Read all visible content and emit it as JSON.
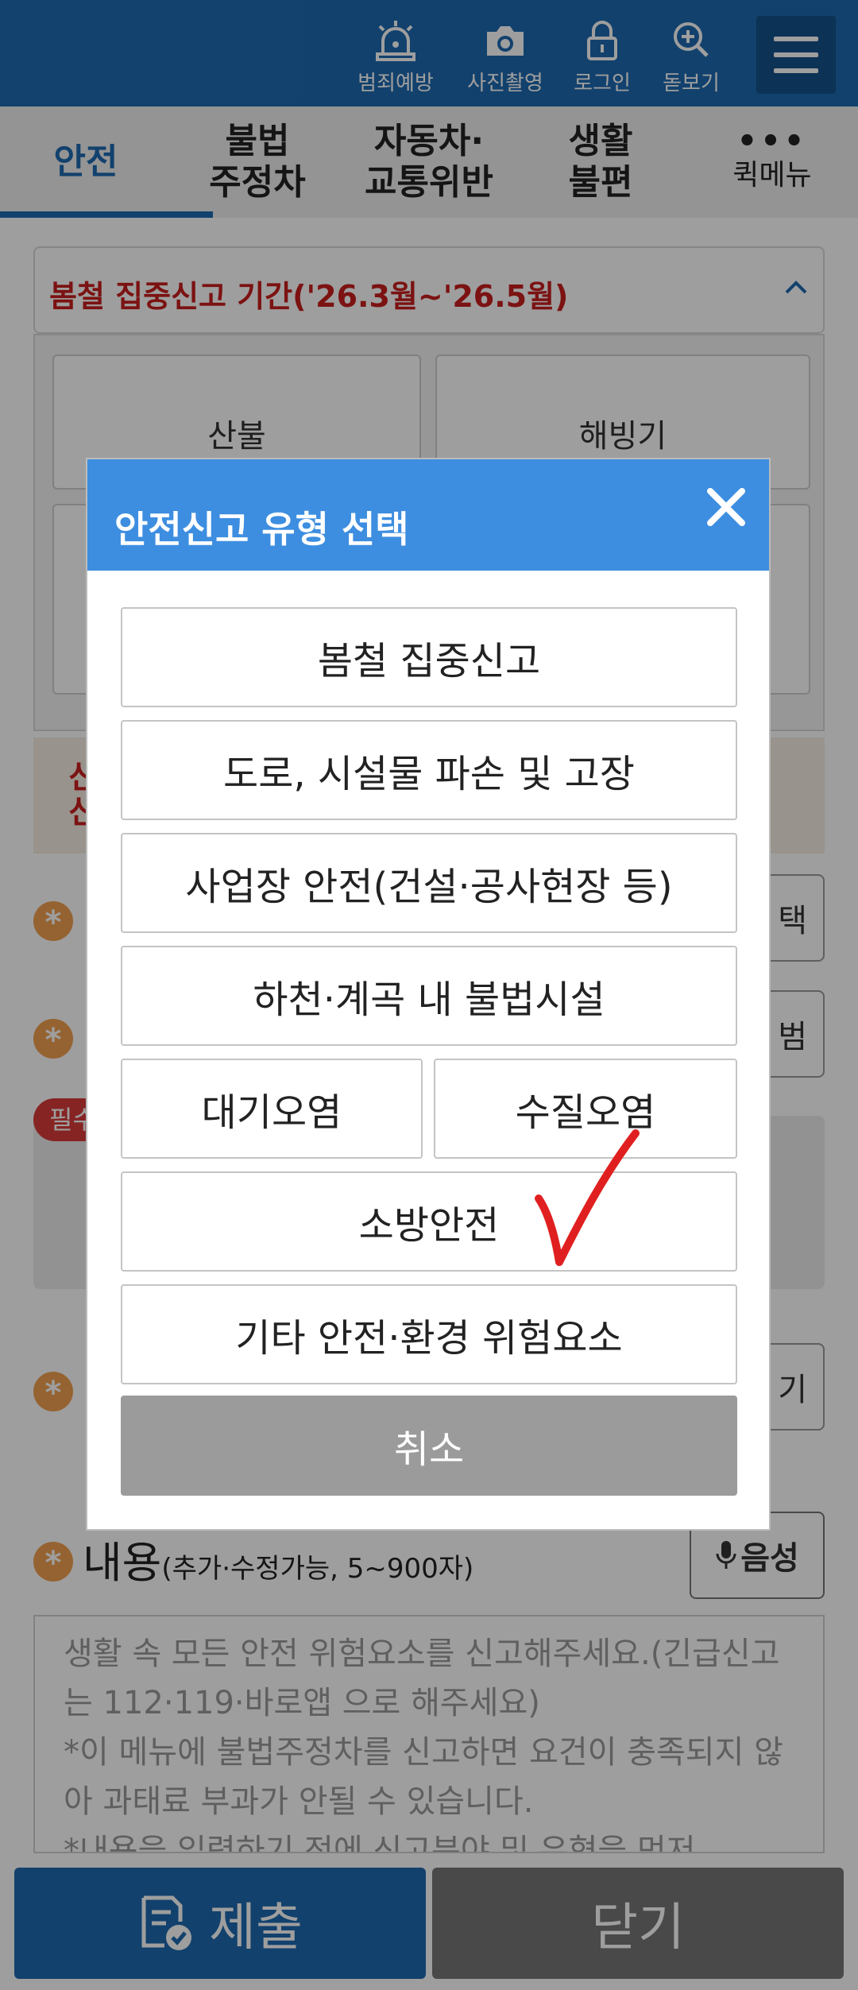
{
  "header": {
    "icons": [
      {
        "name": "siren-icon",
        "label": "범죄예방"
      },
      {
        "name": "camera-icon",
        "label": "사진촬영"
      },
      {
        "name": "lock-icon",
        "label": "로그인"
      },
      {
        "name": "magnifier-icon",
        "label": "돋보기"
      }
    ],
    "menu_icon": "hamburger-icon"
  },
  "tabs": [
    {
      "label": "안전",
      "active": true
    },
    {
      "label": "불법\n주정차"
    },
    {
      "label": "자동차·\n교통위반"
    },
    {
      "label": "생활\n불편"
    },
    {
      "label": "퀵메뉴",
      "icon": "•••"
    }
  ],
  "notice": {
    "text": "봄철 집중신고 기간('26.3월~'26.5월)"
  },
  "categories": [
    {
      "label": "산불\n(불법 취사·소각 등)"
    },
    {
      "label": "해빙기\n(시설물 파손 등)"
    }
  ],
  "content": {
    "label": "내용",
    "hint": "(추가·수정가능, 5~900자)",
    "voice_label": "음성",
    "placeholder": "생활 속 모든 안전 위험요소를 신고해주세요.(긴급신고는 112·119·바로앱 으로 해주세요)\n*이 메뉴에 불법주정차를 신고하면 요건이 충족되지 않아 과태료 부과가 안될 수 있습니다.\n*내용을 입력하기 전에 신고분야 및 유형을 먼저"
  },
  "background_fragments": {
    "side_btn_1": "택",
    "side_btn_2": "범",
    "side_btn_3": "기",
    "required_badge": "필수",
    "banner_text": "신\n신"
  },
  "bottom": {
    "submit_label": "제출",
    "close_label": "닫기"
  },
  "modal": {
    "title": "안전신고 유형 선택",
    "options": [
      "봄철 집중신고",
      "도로, 시설물 파손 및 고장",
      "사업장 안전(건설·공사현장 등)",
      "하천·계곡 내 불법시설",
      "대기오염",
      "수질오염",
      "소방안전",
      "기타 안전·환경 위험요소"
    ],
    "cancel_label": "취소"
  },
  "colors": {
    "primary": "#1d6ab0",
    "modal_header": "#3d8ee0",
    "alert_red": "#c81e1e",
    "checkmark": "#e02020"
  }
}
